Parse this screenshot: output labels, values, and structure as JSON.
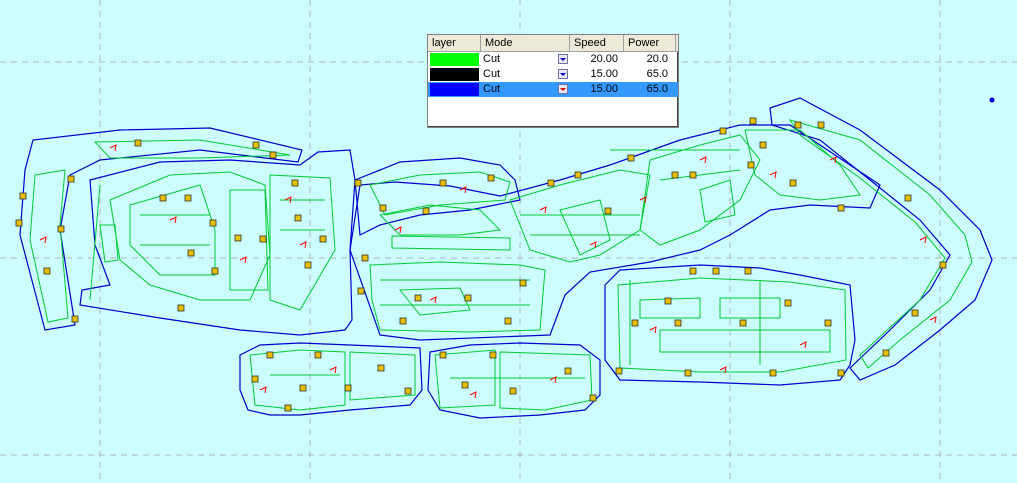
{
  "layer_table": {
    "headers": {
      "layer": "layer",
      "mode": "Mode",
      "speed": "Speed",
      "power": "Power"
    },
    "rows": [
      {
        "color": "#00ff00",
        "mode": "Cut",
        "speed": "20.00",
        "power": "20.0"
      },
      {
        "color": "#000000",
        "mode": "Cut",
        "speed": "15.00",
        "power": "65.0"
      },
      {
        "color": "#0000ff",
        "mode": "Cut",
        "speed": "15.00",
        "power": "65.0",
        "selected": true
      }
    ]
  },
  "colors": {
    "background": "#ccfcfc",
    "grid": "#b0b8c0",
    "inner_cut": "#00cc33",
    "outer_cut": "#0000cc",
    "marker_fill": "#e6c000",
    "direction_arrow": "#ff0000"
  }
}
